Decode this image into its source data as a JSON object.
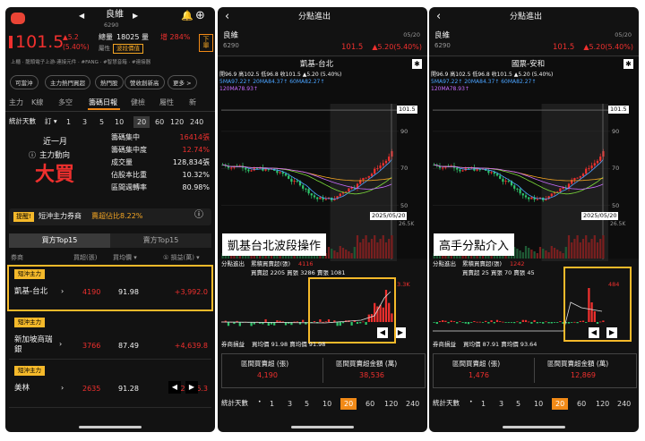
{
  "left": {
    "logo_icon": "robot-mascot-icon",
    "stock_name": "良維",
    "stock_code": "6290",
    "price": "101.5",
    "change": "▲5.2",
    "change_pct": "(5.40%)",
    "total_label": "總量",
    "total_value": "18025 量",
    "total_pct": "增 284%",
    "tag_sector": "屬性",
    "tag_band": "波段價值",
    "order_btn": "下單",
    "tags_line": "上櫃 · 龍頭電子上游-連接元件 · #FANG · #智慧音箱 · #連接器",
    "pills": [
      "可當沖",
      "主力熱門買超",
      "熱門股",
      "營收創新高",
      "更多 >"
    ],
    "tabs": [
      "主力",
      "K線",
      "多空",
      "籌碼日報",
      "健檢",
      "屬性",
      "新"
    ],
    "active_tab": "籌碼日報",
    "stat_label": "統計天數",
    "stat_sub": "訂 ▾",
    "periods": [
      "1",
      "3",
      "5",
      "10",
      "20",
      "60",
      "120",
      "240"
    ],
    "active_period": "20",
    "trend_period": "近一月",
    "trend_label": "主力動向",
    "trend_value": "大買",
    "metrics": [
      {
        "label": "籌碼集中",
        "value": "16414張",
        "color": "red"
      },
      {
        "label": "籌碼集中度",
        "value": "12.74%",
        "color": "red"
      },
      {
        "label": "成交量",
        "value": "128,834張",
        "color": "white"
      },
      {
        "label": "佔股本比重",
        "value": "10.32%",
        "color": "white"
      },
      {
        "label": "區間週轉率",
        "value": "80.98%",
        "color": "white"
      }
    ],
    "notice_tag": "提醒!",
    "notice_text": "短沖主力券商",
    "notice_value": "賣超佔比8.22%",
    "buy_tab": "買方Top15",
    "sell_tab": "賣方Top15",
    "col_broker": "券商",
    "col_buy": "買超(張)",
    "col_avg": "買均價 ▾",
    "col_pnl": "① 損益(萬) ▾",
    "badge": "短沖主力",
    "rows": [
      {
        "name": "凱基-台北",
        "buy": "4190",
        "avg": "91.98",
        "pnl": "+3,992.0"
      },
      {
        "name": "新加坡商瑞銀",
        "buy": "3766",
        "avg": "87.49",
        "pnl": "+4,639.8"
      },
      {
        "name": "美林",
        "buy": "2635",
        "avg": "91.28",
        "pnl": "+2,696.3"
      }
    ]
  },
  "panels": [
    {
      "title": "分點進出",
      "stock_name": "良維",
      "stock_code": "6290",
      "date": "05/20",
      "price": "101.5",
      "change": "▲5.20(5.40%)",
      "broker": "凱基-台北",
      "ohlc_line": "開96.9 高102.5 低96.8 收101.5 ▲5.20 (5.40%)",
      "ma_line1": "5MA97.22↑ 20MA84.37↑ 60MA82.27↑",
      "ma_line2": "120MA78.93↑",
      "y_ticks": [
        "101.5",
        "90",
        "70",
        "50"
      ],
      "date_label": "2025/05/20",
      "vol_label": "26.5K",
      "overlay": "凱基台北波段操作",
      "sub_title": "分點進出",
      "sub_line1_label": "累積買賣超(張)",
      "sub_line1_value": "4116",
      "sub_line2": "買賣超 2205 買張 3286 賣張 1081",
      "sub_max": "3.3K",
      "pnl_label": "券商損益",
      "pnl_line": "買均價 91.98 賣均價 91.98",
      "sum_buy_label": "區間買賣超 (張)",
      "sum_buy_value": "4,190",
      "sum_amt_label": "區間買賣超金額 (萬)",
      "sum_amt_value": "38,536",
      "stat_label": "統計天數"
    },
    {
      "title": "分點進出",
      "stock_name": "良維",
      "stock_code": "6290",
      "date": "05/20",
      "price": "101.5",
      "change": "▲5.20(5.40%)",
      "broker": "國票-安和",
      "ohlc_line": "開96.9 高102.5 低96.8 收101.5 ▲5.20 (5.40%)",
      "ma_line1": "5MA97.22↑ 20MA84.37↑ 60MA82.27↑",
      "ma_line2": "120MA78.93↑",
      "y_ticks": [
        "101.5",
        "90",
        "70",
        "50"
      ],
      "date_label": "2025/05/20",
      "vol_label": "26.5K",
      "overlay": "高手分點介入",
      "sub_title": "分點進出",
      "sub_line1_label": "累積買賣超(張)",
      "sub_line1_value": "1242",
      "sub_line2": "買賣超 25 買張 70 賣張 45",
      "sub_max": "484",
      "pnl_label": "券商損益",
      "pnl_line": "買均價 87.91 賣均價 93.64",
      "sum_buy_label": "區間買賣超 (張)",
      "sum_buy_value": "1,476",
      "sum_amt_label": "區間買賣超金額 (萬)",
      "sum_amt_value": "12,869",
      "stat_label": "統計天數"
    }
  ],
  "periods": [
    "1",
    "3",
    "5",
    "10",
    "20",
    "60",
    "120",
    "240"
  ],
  "active_period": "20",
  "colors": {
    "up": "#f0302e",
    "down": "#2ec56a",
    "accent": "#f28a17",
    "highlight": "#f5b92a"
  }
}
